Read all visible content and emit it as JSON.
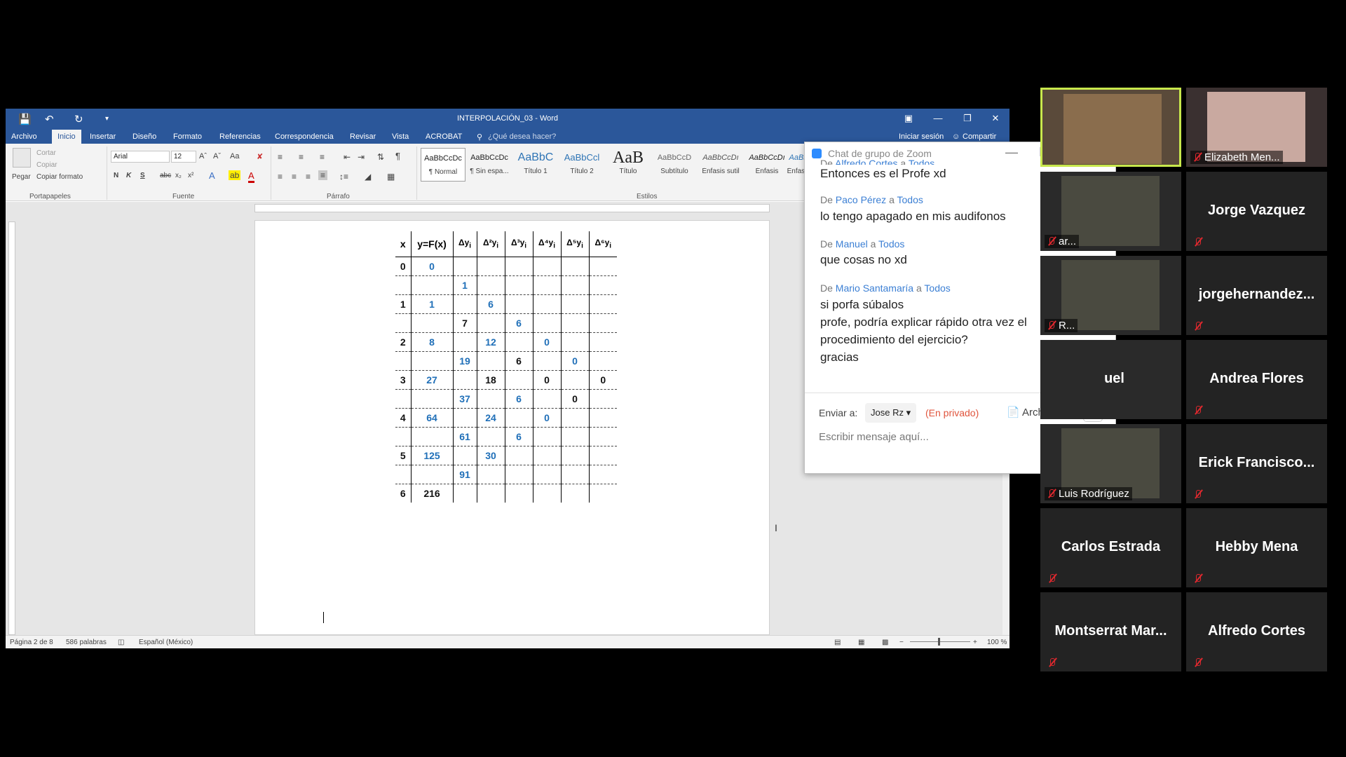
{
  "word": {
    "title": "INTERPOLACIÓN_03 - Word",
    "tabs": [
      "Archivo",
      "Inicio",
      "Insertar",
      "Diseño",
      "Formato",
      "Referencias",
      "Correspondencia",
      "Revisar",
      "Vista",
      "ACROBAT"
    ],
    "tell_me": "¿Qué desea hacer?",
    "signin": "Iniciar sesión",
    "share": "Compartir",
    "clipboard": {
      "paste": "Pegar",
      "cut": "Cortar",
      "copy": "Copiar",
      "format_painter": "Copiar formato",
      "label": "Portapapeles"
    },
    "font": {
      "name": "Arial",
      "size": "12",
      "label": "Fuente",
      "bold": "N",
      "italic": "K",
      "underline": "S",
      "strike": "abc",
      "sub": "x₂",
      "sup": "x²",
      "case": "Aa"
    },
    "paragraph": {
      "label": "Párrafo"
    },
    "styles": {
      "label": "Estilos",
      "items": [
        {
          "preview": "AaBbCcDc",
          "name": "¶ Normal"
        },
        {
          "preview": "AaBbCcDc",
          "name": "¶ Sin espa..."
        },
        {
          "preview": "AaBbC",
          "name": "Título 1"
        },
        {
          "preview": "AaBbCcl",
          "name": "Título 2"
        },
        {
          "preview": "AaB",
          "name": "Título"
        },
        {
          "preview": "AaBbCcD",
          "name": "Subtítulo"
        },
        {
          "preview": "AaBbCcDı",
          "name": "Énfasis sutil"
        },
        {
          "preview": "AaBbCcDı",
          "name": "Énfasis"
        },
        {
          "preview": "AaBb",
          "name": "Énfasis"
        }
      ]
    },
    "status": {
      "page": "Página 2 de 8",
      "words": "586 palabras",
      "lang": "Español (México)",
      "zoom": "100 %"
    },
    "table": {
      "headers": [
        "x",
        "y=F(x)",
        "Δy",
        "Δ²y",
        "Δ³y",
        "Δ⁴y",
        "Δ⁵y",
        "Δ⁶y"
      ],
      "header_sub": "i",
      "rows": [
        [
          "0",
          "0",
          "",
          "",
          "",
          "",
          "",
          ""
        ],
        [
          "",
          "",
          "1",
          "",
          "",
          "",
          "",
          ""
        ],
        [
          "1",
          "1",
          "",
          "6",
          "",
          "",
          "",
          ""
        ],
        [
          "",
          "",
          "7",
          "",
          "6",
          "",
          "",
          ""
        ],
        [
          "2",
          "8",
          "",
          "12",
          "",
          "0",
          "",
          ""
        ],
        [
          "",
          "",
          "19",
          "",
          "6",
          "",
          "0",
          ""
        ],
        [
          "3",
          "27",
          "",
          "18",
          "",
          "0",
          "",
          "0"
        ],
        [
          "",
          "",
          "37",
          "",
          "6",
          "",
          "0",
          ""
        ],
        [
          "4",
          "64",
          "",
          "24",
          "",
          "0",
          "",
          ""
        ],
        [
          "",
          "",
          "61",
          "",
          "6",
          "",
          "",
          ""
        ],
        [
          "5",
          "125",
          "",
          "30",
          "",
          "",
          "",
          ""
        ],
        [
          "",
          "",
          "91",
          "",
          "",
          "",
          "",
          ""
        ],
        [
          "6",
          "216",
          "",
          "",
          "",
          "",
          "",
          ""
        ]
      ],
      "colors": {
        "blue": "#1f6fb8",
        "dark_cells": [
          "3-2",
          "6-3",
          "6-5",
          "6-7",
          "7-6",
          "12-1",
          "5-4"
        ]
      }
    }
  },
  "chat": {
    "title": "Chat de grupo de Zoom",
    "messages": [
      {
        "sender": "Alfredo Cortes",
        "to": "Todos",
        "lines": [
          "Entonces es el Profe xd"
        ]
      },
      {
        "sender": "Paco Pérez",
        "to": "Todos",
        "lines": [
          "lo tengo apagado en mis audifonos"
        ]
      },
      {
        "sender": "Manuel",
        "to": "Todos",
        "lines": [
          "que cosas no xd"
        ]
      },
      {
        "sender": "Mario Santamaría",
        "to": "Todos",
        "lines": [
          "si porfa súbalos",
          "profe, podría explicar rápido otra vez el",
          "procedimiento del ejercicio?",
          "gracias"
        ]
      }
    ],
    "de": "De",
    "a": "a",
    "send_to": "Enviar a:",
    "recipient": "Jose Rz",
    "private": "(En privado)",
    "file": "Archivo",
    "more": "···",
    "placeholder": "Escribir mensaje aquí..."
  },
  "gallery": [
    {
      "name": "",
      "label": "",
      "video": true,
      "active": true
    },
    {
      "name": "",
      "label": "Elizabeth Men...",
      "video": true
    },
    {
      "name": "",
      "label": "ar...",
      "video": true,
      "partial": true
    },
    {
      "name": "Jorge Vazquez",
      "label": ""
    },
    {
      "name": "",
      "label": "R...",
      "video": true,
      "partial": true
    },
    {
      "name": "jorgehernandez...",
      "label": ""
    },
    {
      "name": "uel",
      "label": "",
      "partial": true
    },
    {
      "name": "Andrea Flores",
      "label": ""
    },
    {
      "name": "",
      "label": "Luis Rodríguez",
      "video": true,
      "partial": true
    },
    {
      "name": "Erick  Francisco...",
      "label": ""
    },
    {
      "name": "Carlos Estrada",
      "label": ""
    },
    {
      "name": "Hebby Mena",
      "label": ""
    },
    {
      "name": "Montserrat  Mar...",
      "label": ""
    },
    {
      "name": "Alfredo Cortes",
      "label": ""
    }
  ]
}
